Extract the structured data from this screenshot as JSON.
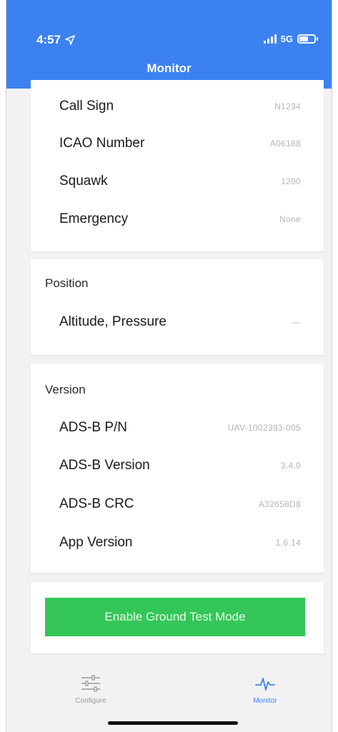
{
  "status_bar": {
    "time": "4:57",
    "network": "5G"
  },
  "header": {
    "title": "Monitor"
  },
  "identification": {
    "rows": [
      {
        "label": "Call Sign",
        "value": "N1234"
      },
      {
        "label": "ICAO Number",
        "value": "A06188"
      },
      {
        "label": "Squawk",
        "value": "1200"
      },
      {
        "label": "Emergency",
        "value": "None"
      }
    ]
  },
  "position": {
    "title": "Position",
    "rows": [
      {
        "label": "Altitude, Pressure",
        "value": "—"
      }
    ]
  },
  "version": {
    "title": "Version",
    "rows": [
      {
        "label": "ADS-B P/N",
        "value": "UAV-1002393-005"
      },
      {
        "label": "ADS-B Version",
        "value": "3.4.0"
      },
      {
        "label": "ADS-B CRC",
        "value": "A32658D8"
      },
      {
        "label": "App Version",
        "value": "1.6.14"
      }
    ]
  },
  "actions": {
    "ground_test_label": "Enable Ground Test Mode"
  },
  "tabbar": {
    "configure_label": "Configure",
    "monitor_label": "Monitor"
  },
  "colors": {
    "header": "#3b82f0",
    "button": "#34c659",
    "active_tab": "#3b82f0"
  }
}
